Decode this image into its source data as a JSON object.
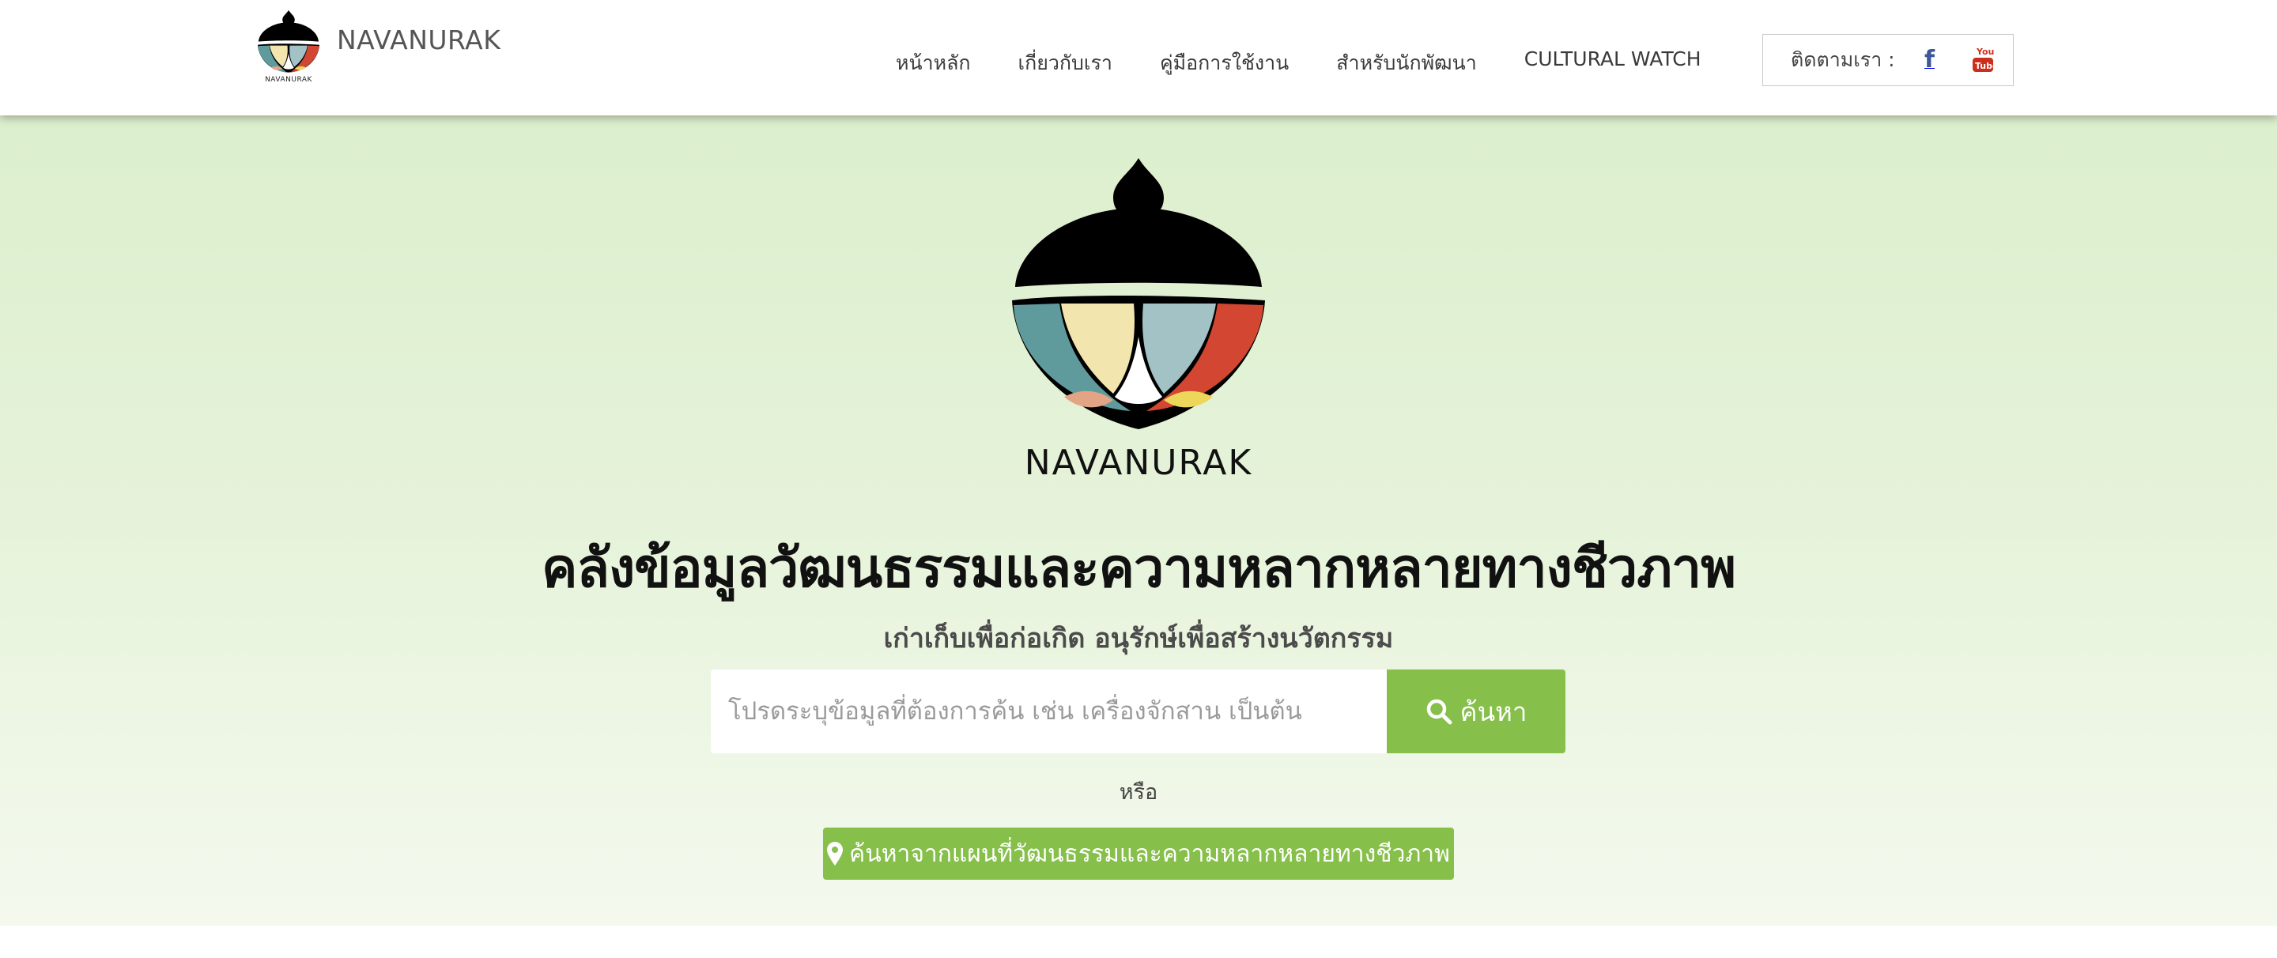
{
  "header": {
    "brand_name": "NAVANURAK",
    "logo_caption": "NAVANURAK",
    "nav": [
      {
        "label": "หน้าหลัก"
      },
      {
        "label": "เกี่ยวกับเรา"
      },
      {
        "label": "คู่มือการใช้งาน"
      },
      {
        "label": "สำหรับนักพัฒนา"
      },
      {
        "label": "CULTURAL WATCH"
      }
    ],
    "follow": {
      "label": "ติดตามเรา :",
      "icons": [
        "facebook-icon",
        "youtube-icon"
      ],
      "facebook_glyph": "f"
    }
  },
  "hero": {
    "logo_text": "NAVANURAK",
    "title": "คลังข้อมูลวัฒนธรรมและความหลากหลายทางชีวภาพ",
    "subtitle": "เก่าเก็บเพื่อก่อเกิด อนุรักษ์เพื่อสร้างนวัตกรรม",
    "search": {
      "placeholder": "โปรดระบุข้อมูลที่ต้องการค้น เช่น เครื่องจักสาน เป็นต้น",
      "value": "",
      "button_label": "ค้นหา"
    },
    "or_text": "หรือ",
    "map_button_label": "ค้นหาจากแผนที่วัฒนธรรมและความหลากหลายทางชีวภาพ"
  },
  "colors": {
    "accent_green": "#86bf4a",
    "facebook_blue": "#3b5998",
    "youtube_red": "#cc2e1e",
    "logo_teal": "#5f9b9d",
    "logo_cream": "#f2e6ae",
    "logo_lightblue": "#a3c2c6",
    "logo_red": "#d24632",
    "logo_salmon": "#e3a385",
    "logo_yellow": "#ecd75a"
  }
}
